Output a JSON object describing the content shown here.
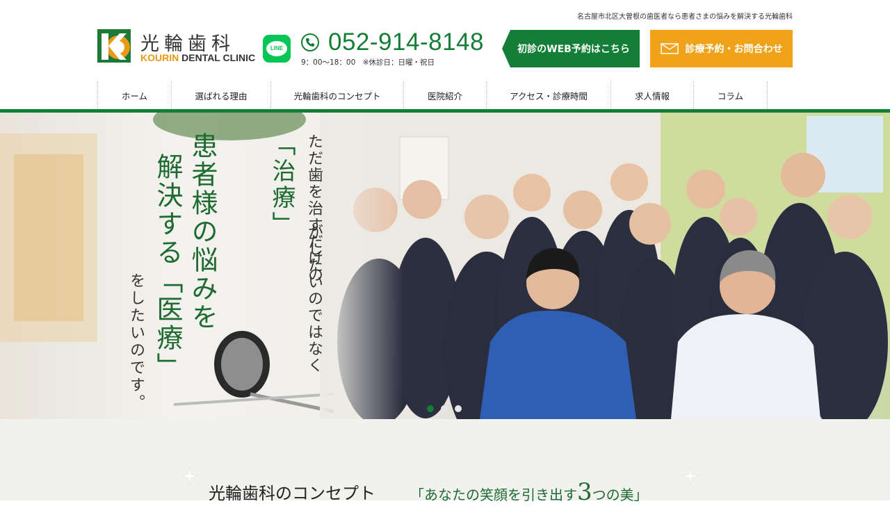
{
  "header": {
    "tagline": "名古屋市北区大曽根の歯医者なら患者さまの悩みを解決する光輪歯科",
    "logo_jp": "光輪歯科",
    "logo_en_accent": "KOURIN",
    "logo_en_rest": " DENTAL CLINIC",
    "line_label": "LINE",
    "phone": "052-914-8148",
    "hours": "9：00〜18：00　※休診日：日曜・祝日",
    "web_reserve_label": "初診のWEB予約はこちら",
    "contact_label": "診療予約・お問合わせ"
  },
  "nav": {
    "items": [
      {
        "label": "ホーム"
      },
      {
        "label": "選ばれる理由"
      },
      {
        "label": "光輪歯科のコンセプト"
      },
      {
        "label": "医院紹介"
      },
      {
        "label": "アクセス・診療時間"
      },
      {
        "label": "求人情報"
      },
      {
        "label": "コラム"
      }
    ]
  },
  "hero": {
    "line1": "ただ歯を治すだけの",
    "line2": "「治療」",
    "line3": "がしたいのではなく",
    "line4": "患者様の悩みを",
    "line5": "解決する「医療」",
    "line6": "をしたいのです。",
    "slides_total": 3,
    "active_slide": 1
  },
  "concept": {
    "title": "光輪歯科のコンセプト",
    "sub_prefix": "「あなたの笑顔を引き出す",
    "sub_number": "3",
    "sub_suffix": "つの美」"
  },
  "colors": {
    "brand_green": "#137e35",
    "accent_orange": "#f0a219",
    "line_green": "#06c755"
  }
}
